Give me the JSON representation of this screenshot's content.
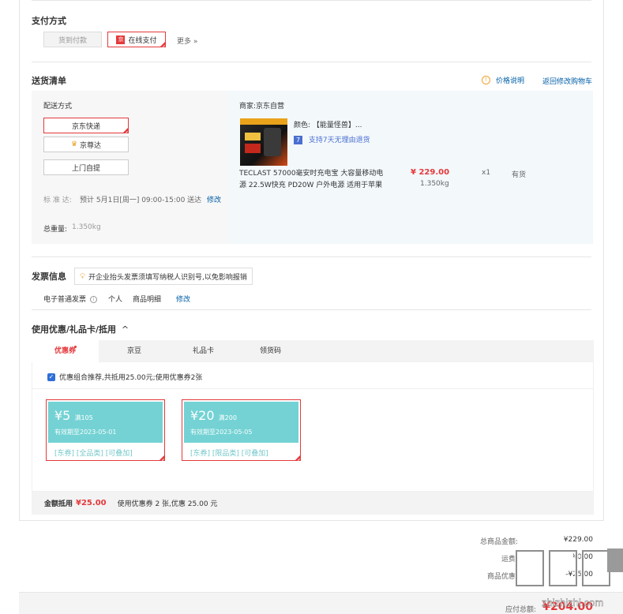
{
  "payment": {
    "title": "支付方式",
    "cod_label": "货到付款",
    "online_label": "在线支付",
    "online_icon": "京",
    "more_label": "更多 »"
  },
  "shipping_list": {
    "title": "送货清单",
    "price_note": "价格说明",
    "back_to_cart": "返回修改购物车",
    "delivery_method_label": "配送方式",
    "methods": [
      "京东快递",
      "京尊达",
      "上门自提"
    ],
    "standard_label": "标 准 达:",
    "standard_value": "预计 5月1日[周一] 09:00-15:00 送达",
    "standard_modify": "修改",
    "total_weight_label": "总重量:",
    "total_weight_value": "1.350kg",
    "merchant": "商家:京东自营",
    "product": {
      "color_label": "颜色:",
      "color_value": "【能量怪兽】...",
      "return_tag_icon": "7",
      "return_tag": "支持7天无理由退货",
      "name_line1": "TECLAST 57000毫安时充电宝 大容量移动电",
      "name_line2": "源 22.5W快充 PD20W 户外电源 适用于苹果",
      "price": "¥ 229.00",
      "weight": "1.350kg",
      "qty": "x1",
      "stock": "有货"
    }
  },
  "invoice": {
    "title": "发票信息",
    "tip": "开企业抬头发票须填写纳税人识别号,以免影响报销",
    "type": "电子普通发票",
    "person": "个人",
    "detail": "商品明细",
    "modify": "修改"
  },
  "coupon": {
    "title": "使用优惠/礼品卡/抵用",
    "caret": "^",
    "tabs": [
      "优惠券",
      "京豆",
      "礼品卡",
      "领货码"
    ],
    "recommend_text": "优惠组合推荐,共抵用25.00元;使用优惠券2张",
    "recommend_checked": true,
    "coupons": [
      {
        "amount": "¥5",
        "condition": "满105",
        "valid": "有效期至2023-05-01",
        "tags": "[东券] [全品类] [可叠加]"
      },
      {
        "amount": "¥20",
        "condition": "满200",
        "valid": "有效期至2023-05-05",
        "tags": "[东券] [限品类] [可叠加]"
      }
    ],
    "summary_label": "金额抵用",
    "summary_amount": "¥25.00",
    "summary_detail": "使用优惠券 2 张,优惠 25.00 元"
  },
  "totals": {
    "goods_label": "总商品金额:",
    "goods_value": "¥229.00",
    "freight_label": "运费:",
    "freight_value": "¥0.00",
    "discount_label": "商品优惠:",
    "discount_value": "-¥25.00",
    "payable_label": "应付总额:",
    "payable_value": "¥204.00"
  },
  "watermark": "zhizhizhi.com",
  "colors": {
    "accent": "#e4393c",
    "link": "#005ea7",
    "coupon": "#74d2d4"
  }
}
